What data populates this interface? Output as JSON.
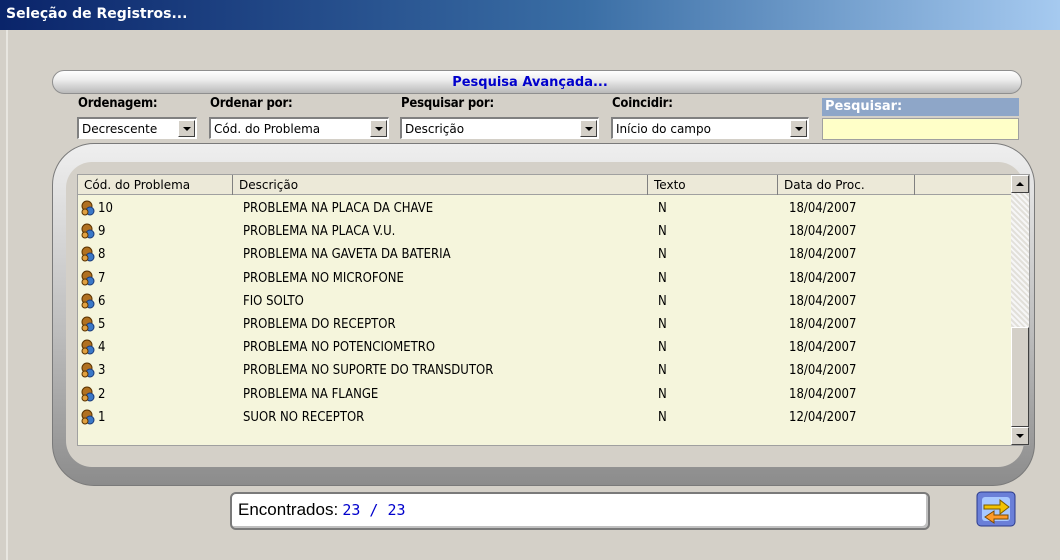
{
  "window": {
    "title": "Seleção de Registros..."
  },
  "search": {
    "title": "Pesquisa Avançada...",
    "fields": [
      {
        "label": "Ordenagem:",
        "value": "Decrescente"
      },
      {
        "label": "Ordenar por:",
        "value": "Cód. do Problema"
      },
      {
        "label": "Pesquisar por:",
        "value": "Descrição"
      },
      {
        "label": "Coincidir:",
        "value": "Início do campo"
      }
    ],
    "query_label": "Pesquisar:",
    "query_value": ""
  },
  "grid": {
    "columns": [
      "Cód. do Problema",
      "Descrição",
      "Texto",
      "Data do Proc."
    ],
    "rows": [
      {
        "code": "10",
        "desc": "PROBLEMA NA PLACA DA CHAVE",
        "text": "N",
        "date": "18/04/2007"
      },
      {
        "code": "9",
        "desc": "PROBLEMA NA PLACA V.U.",
        "text": "N",
        "date": "18/04/2007"
      },
      {
        "code": "8",
        "desc": "PROBLEMA NA GAVETA DA BATERIA",
        "text": "N",
        "date": "18/04/2007"
      },
      {
        "code": "7",
        "desc": "PROBLEMA NO MICROFONE",
        "text": "N",
        "date": "18/04/2007"
      },
      {
        "code": "6",
        "desc": "FIO SOLTO",
        "text": "N",
        "date": "18/04/2007"
      },
      {
        "code": "5",
        "desc": "PROBLEMA DO RECEPTOR",
        "text": "N",
        "date": "18/04/2007"
      },
      {
        "code": "4",
        "desc": "PROBLEMA NO POTENCIOMETRO",
        "text": "N",
        "date": "18/04/2007"
      },
      {
        "code": "3",
        "desc": "PROBLEMA NO SUPORTE DO TRANSDUTOR",
        "text": "N",
        "date": "18/04/2007"
      },
      {
        "code": "2",
        "desc": "PROBLEMA NA FLANGE",
        "text": "N",
        "date": "18/04/2007"
      },
      {
        "code": "1",
        "desc": "SUOR NO RECEPTOR",
        "text": "N",
        "date": "12/04/2007"
      }
    ],
    "row_icon": "record-icon"
  },
  "status": {
    "label": "Encontrados:",
    "count": "23 / 23"
  },
  "refresh_icon": "refresh-arrows-icon"
}
